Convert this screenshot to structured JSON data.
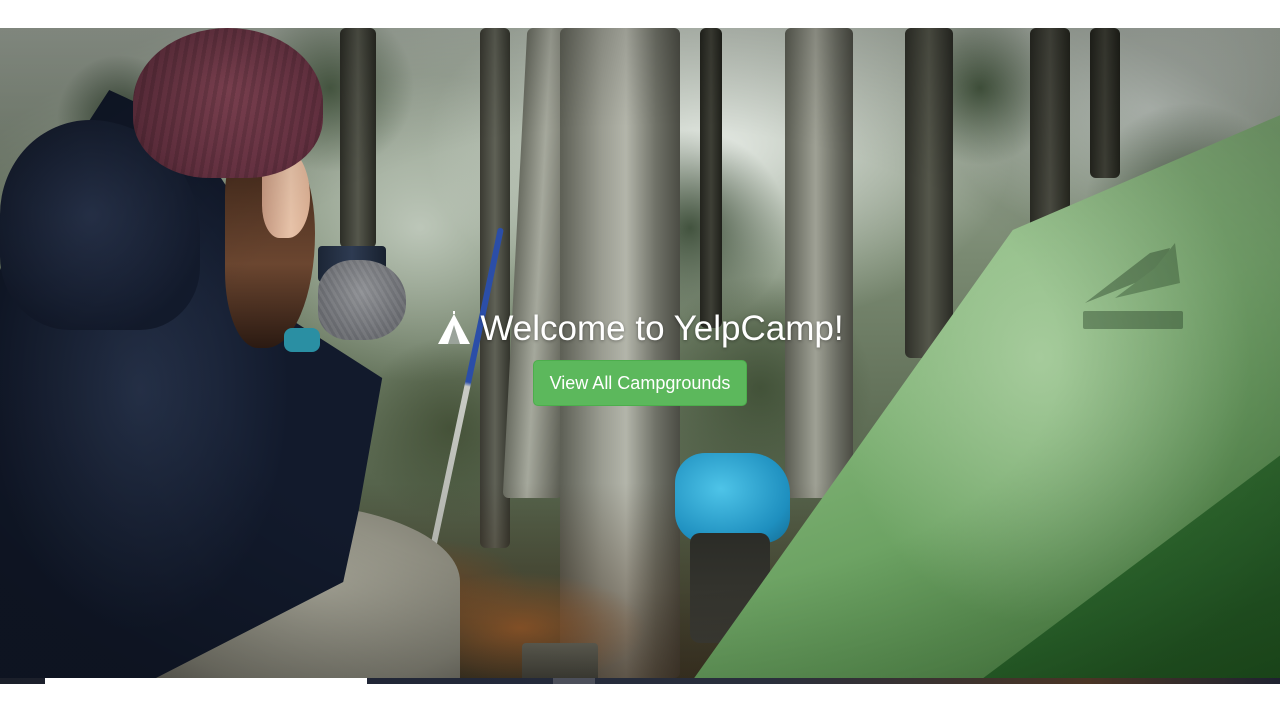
{
  "landing": {
    "title": "Welcome to YelpCamp!",
    "cta_label": "View All Campgrounds",
    "title_icon": "tent-icon",
    "tent_logo_icon": "msr-logo-icon"
  },
  "colors": {
    "cta_background": "#5cb85c",
    "cta_border": "#4cae4c",
    "title_text": "#ffffff",
    "page_background": "#ffffff"
  }
}
